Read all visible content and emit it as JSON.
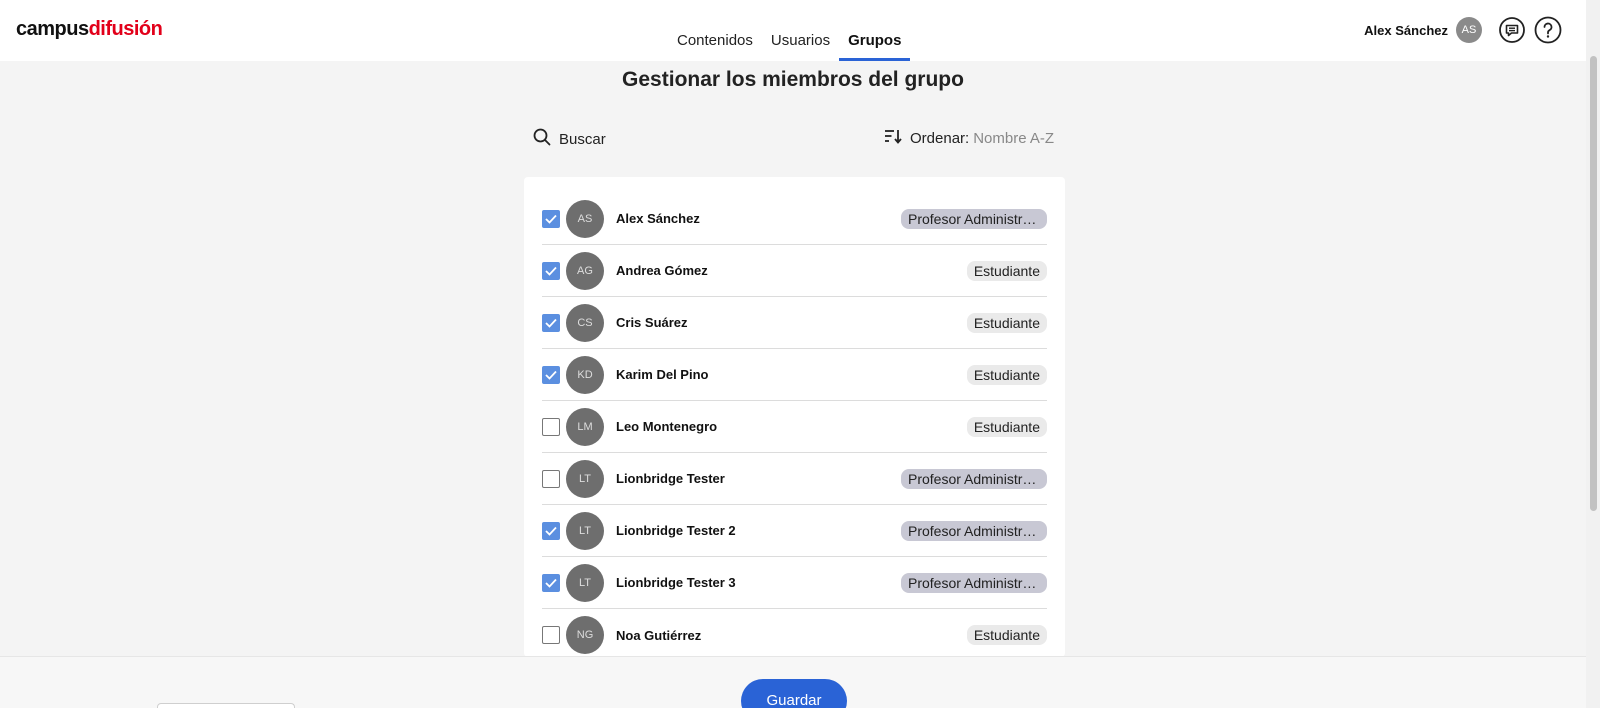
{
  "logo": {
    "part1": "campus",
    "part2": "difusión"
  },
  "nav": {
    "items": [
      {
        "label": "Contenidos",
        "active": false
      },
      {
        "label": "Usuarios",
        "active": false
      },
      {
        "label": "Grupos",
        "active": true
      }
    ]
  },
  "user": {
    "name": "Alex Sánchez",
    "initials": "AS"
  },
  "page": {
    "title": "Gestionar los miembros del grupo"
  },
  "search": {
    "label": "Buscar"
  },
  "sort": {
    "label": "Ordenar:",
    "value": "Nombre A-Z"
  },
  "members": [
    {
      "initials": "AS",
      "name": "Alex Sánchez",
      "role": "Profesor Administrador",
      "checked": true
    },
    {
      "initials": "AG",
      "name": "Andrea Gómez",
      "role": "Estudiante",
      "checked": true
    },
    {
      "initials": "CS",
      "name": "Cris Suárez",
      "role": "Estudiante",
      "checked": true
    },
    {
      "initials": "KD",
      "name": "Karim Del Pino",
      "role": "Estudiante",
      "checked": true
    },
    {
      "initials": "LM",
      "name": "Leo Montenegro",
      "role": "Estudiante",
      "checked": false
    },
    {
      "initials": "LT",
      "name": "Lionbridge Tester",
      "role": "Profesor Administrador",
      "checked": false
    },
    {
      "initials": "LT",
      "name": "Lionbridge Tester 2",
      "role": "Profesor Administrador",
      "checked": true
    },
    {
      "initials": "LT",
      "name": "Lionbridge Tester 3",
      "role": "Profesor Administrador",
      "checked": true
    },
    {
      "initials": "NG",
      "name": "Noa Gutiérrez",
      "role": "Estudiante",
      "checked": false
    }
  ],
  "footer": {
    "save_label": "Guardar"
  },
  "colors": {
    "accent": "#2a63d6",
    "checkbox": "#5b8fe0",
    "brand_red": "#e2001a"
  }
}
